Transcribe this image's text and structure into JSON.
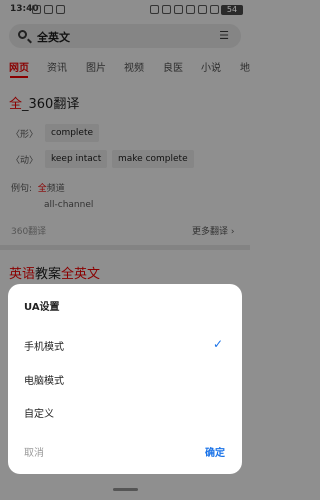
{
  "status": {
    "time": "13:40",
    "battery": "54"
  },
  "search": {
    "query": "全英文"
  },
  "tabs": [
    "网页",
    "资讯",
    "图片",
    "视频",
    "良医",
    "小说",
    "地"
  ],
  "result1": {
    "title_highlight": "全",
    "title_rest": "_360翻译",
    "pos1": "〈形〉",
    "chip1": "complete",
    "pos2": "〈动〉",
    "chip2": "keep intact",
    "chip3": "make complete",
    "example_label": "例句:",
    "example_highlight": "全",
    "example_rest": "频道",
    "example_translation": "all-channel",
    "source": "360翻译",
    "more": "更多翻译 ›"
  },
  "result2": {
    "title_hl1": "英语",
    "title_mid": "教案",
    "title_hl2": "全英文"
  },
  "sheet": {
    "title": "UA设置",
    "options": [
      "手机模式",
      "电脑模式",
      "自定义"
    ],
    "selected_index": 0,
    "cancel": "取消",
    "confirm": "确定"
  }
}
